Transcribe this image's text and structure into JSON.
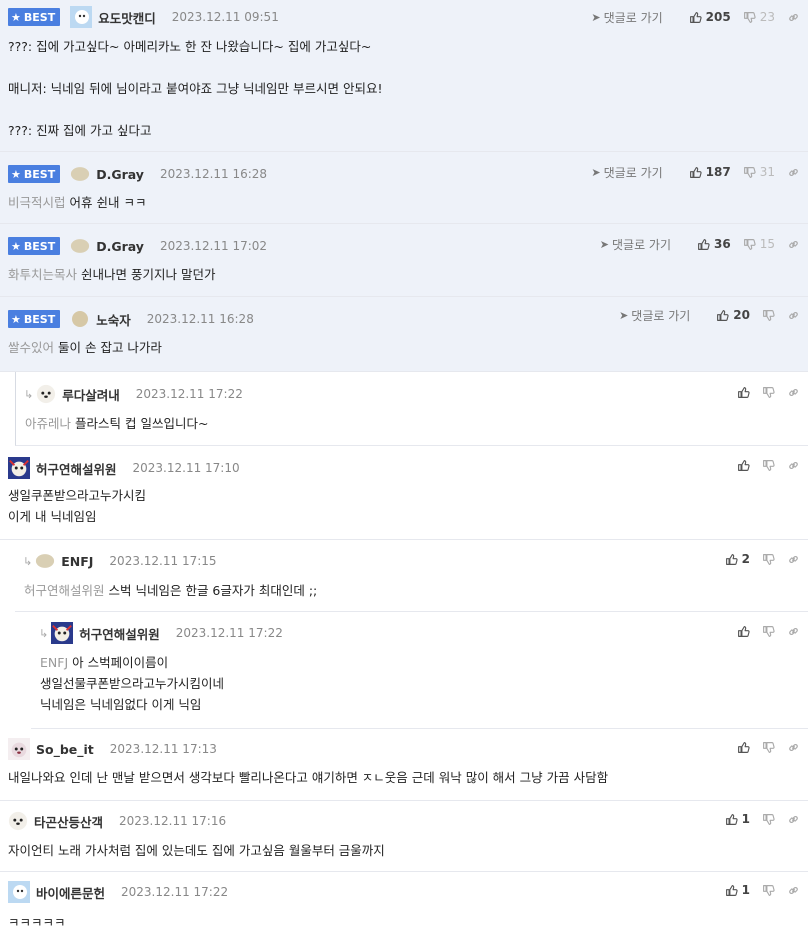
{
  "ui": {
    "best_label": "BEST",
    "reply_goto": "댓글로 가기"
  },
  "comments": [
    {
      "nick": "요도맛캔디",
      "date": "2023.12.11 09:51",
      "up": "205",
      "down": "23",
      "lines": [
        "???: 집에 가고싶다~ 아메리카노 한 잔 나왔습니다~ 집에 가고싶다~",
        "",
        "매니저: 닉네임 뒤에 님이라고 붙여야죠 그냥 닉네임만 부르시면 안되요!",
        "",
        "???: 진짜 집에 가고 싶다고"
      ]
    },
    {
      "nick": "D.Gray",
      "date": "2023.12.11 16:28",
      "up": "187",
      "down": "31",
      "mention": "비극적시럽",
      "text": "어휴 쉰내 ㅋㅋ"
    },
    {
      "nick": "D.Gray",
      "date": "2023.12.11 17:02",
      "up": "36",
      "down": "15",
      "mention": "화투치는목사",
      "text": "쉰내나면 풍기지나 말던가"
    },
    {
      "nick": "노숙자",
      "date": "2023.12.11 16:28",
      "up": "20",
      "mention": "쌀수있어",
      "text": "둘이 손 잡고 나가라"
    },
    {
      "nick": "루다살려내",
      "date": "2023.12.11 17:22",
      "mention": "아쥬레나",
      "text": "플라스틱 컵 일쓰입니다~"
    },
    {
      "nick": "허구연해설위원",
      "date": "2023.12.11 17:10",
      "lines": [
        "생일쿠폰받으라고누가시킴",
        "이게 내 닉네임임"
      ]
    },
    {
      "nick": "ENFJ",
      "date": "2023.12.11 17:15",
      "up": "2",
      "mention": "허구연해설위원",
      "text": "스벅 닉네임은 한글 6글자가 최대인데 ;;"
    },
    {
      "nick": "허구연해설위원",
      "date": "2023.12.11 17:22",
      "mention": "ENFJ",
      "lines": [
        "아 스벅페이이름이",
        "생일선물쿠폰받으라고누가시킴이네",
        "닉네임은 닉네임없다 이게 닉임"
      ]
    },
    {
      "nick": "So_be_it",
      "date": "2023.12.11 17:13",
      "text": "내일나와요 인데 난 맨날 받으면서 생각보다 빨리나온다고 얘기하면 ㅈㄴ웃음 근데 워낙 많이 해서 그냥 가끔 사담함"
    },
    {
      "nick": "타곤산등산객",
      "date": "2023.12.11 17:16",
      "up": "1",
      "text": "자이언티 노래 가사처럼 집에 있는데도 집에 가고싶음 월울부터 금울까지"
    },
    {
      "nick": "바이에른문헌",
      "date": "2023.12.11 17:22",
      "up": "1",
      "text": "ㅋㅋㅋㅋㅋ"
    }
  ]
}
